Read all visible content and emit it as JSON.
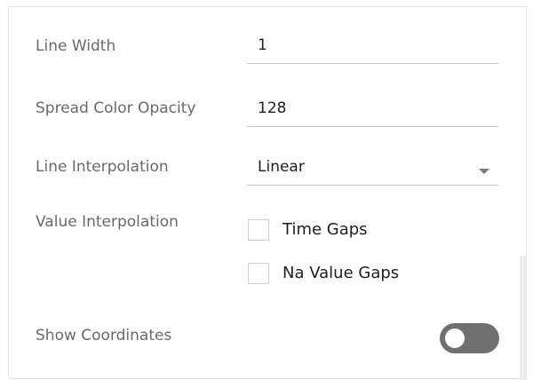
{
  "settings": {
    "line_width": {
      "label": "Line Width",
      "value": "1"
    },
    "spread_color_opacity": {
      "label": "Spread Color Opacity",
      "value": "128"
    },
    "line_interpolation": {
      "label": "Line Interpolation",
      "value": "Linear"
    },
    "value_interpolation": {
      "label": "Value Interpolation",
      "options": [
        {
          "label": "Time Gaps",
          "checked": false
        },
        {
          "label": "Na Value Gaps",
          "checked": false
        }
      ]
    },
    "show_coordinates": {
      "label": "Show Coordinates",
      "enabled": false
    }
  },
  "colors": {
    "toggle_off": "#707070",
    "label_text": "#6a6a6a",
    "value_text": "#1e1e1e",
    "underline": "#c7c7c7"
  }
}
